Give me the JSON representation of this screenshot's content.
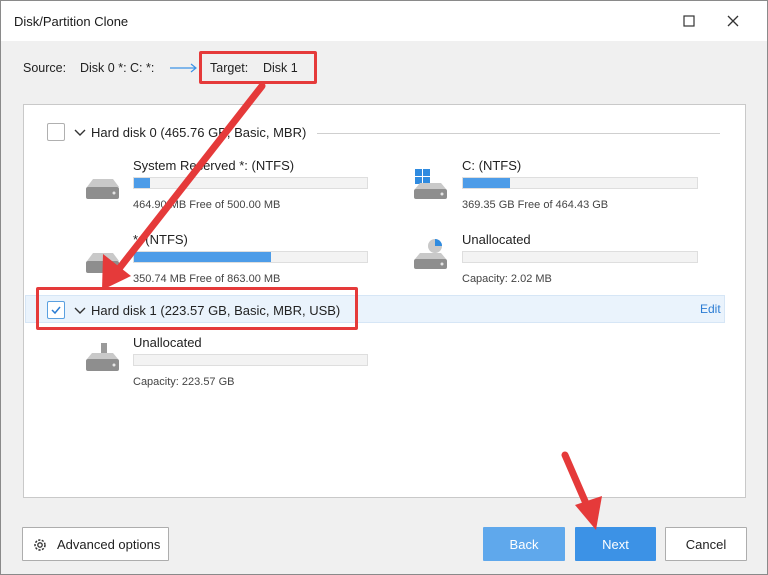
{
  "window": {
    "title": "Disk/Partition Clone"
  },
  "source_bar": {
    "source_label": "Source:",
    "source_value": "Disk 0 *: C: *:",
    "target_label": "Target:",
    "target_value": "Disk 1"
  },
  "disks": [
    {
      "title": "Hard disk 0 (465.76 GB, Basic, MBR)",
      "checked": false,
      "partitions": [
        {
          "name": "System Reserved *: (NTFS)",
          "info": "464.90 MB Free of 500.00 MB",
          "used_fraction": 0.07,
          "icon": "hard-drive-icon"
        },
        {
          "name": "C: (NTFS)",
          "info": "369.35 GB Free of 464.43 GB",
          "used_fraction": 0.2,
          "icon": "windows-drive-icon"
        },
        {
          "name": "*: (NTFS)",
          "info": "350.74 MB Free of 863.00 MB",
          "used_fraction": 0.59,
          "icon": "hard-drive-icon"
        },
        {
          "name": "Unallocated",
          "info": "Capacity: 2.02 MB",
          "used_fraction": 0,
          "icon": "pie-drive-icon"
        }
      ]
    },
    {
      "title": "Hard disk 1 (223.57 GB, Basic, MBR, USB)",
      "checked": true,
      "edit_label": "Edit",
      "partitions": [
        {
          "name": "Unallocated",
          "info": "Capacity: 223.57 GB",
          "used_fraction": 0,
          "icon": "usb-drive-icon"
        }
      ]
    }
  ],
  "footer": {
    "advanced_label": "Advanced options",
    "back_label": "Back",
    "next_label": "Next",
    "cancel_label": "Cancel"
  },
  "colors": {
    "accent": "#3c92e6",
    "bar_fill": "#4d9ce8",
    "highlight_red": "#e53a3a",
    "selected_row": "#eaf3fc"
  }
}
